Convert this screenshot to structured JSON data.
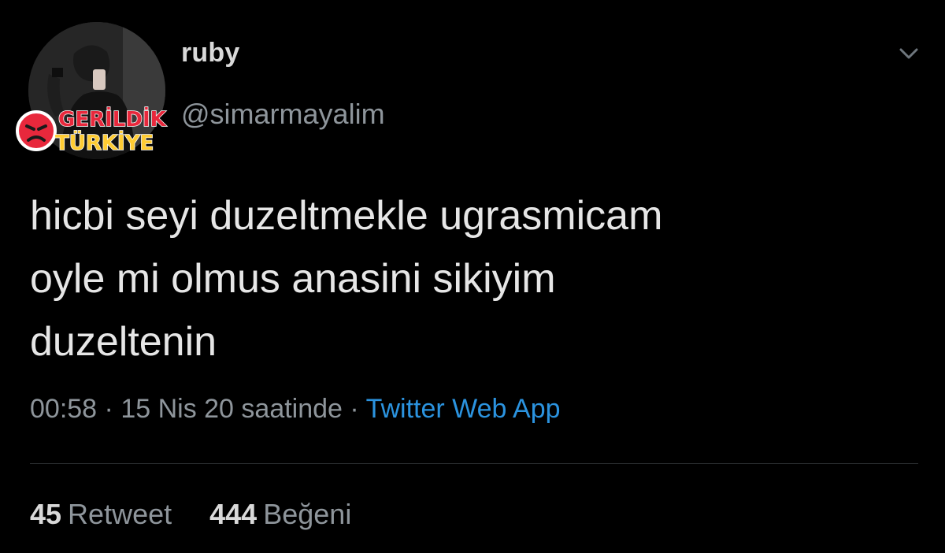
{
  "tweet": {
    "display_name": "ruby",
    "handle": "@simarmayalim",
    "text": "hicbi seyi duzeltmekle ugrasmicam\noyle mi olmus anasini sikiyim\nduzeltenin",
    "time": "00:58",
    "date_text": "15 Nis 20 saatinde",
    "separator": "·",
    "source": "Twitter Web App",
    "retweet_count": "45",
    "retweet_label": "Retweet",
    "like_count": "444",
    "like_label": "Beğeni"
  },
  "watermark": {
    "line1": "GERİLDİK",
    "line2": "TÜRKİYE"
  },
  "icons": {
    "menu": "chevron-down-icon",
    "watermark_face": "angry-face-icon"
  },
  "colors": {
    "background": "#000000",
    "text": "#d9d9d9",
    "secondary": "#8e959b",
    "link": "#2b93df",
    "watermark_red": "#e8283c",
    "watermark_yellow": "#ffcc33"
  }
}
